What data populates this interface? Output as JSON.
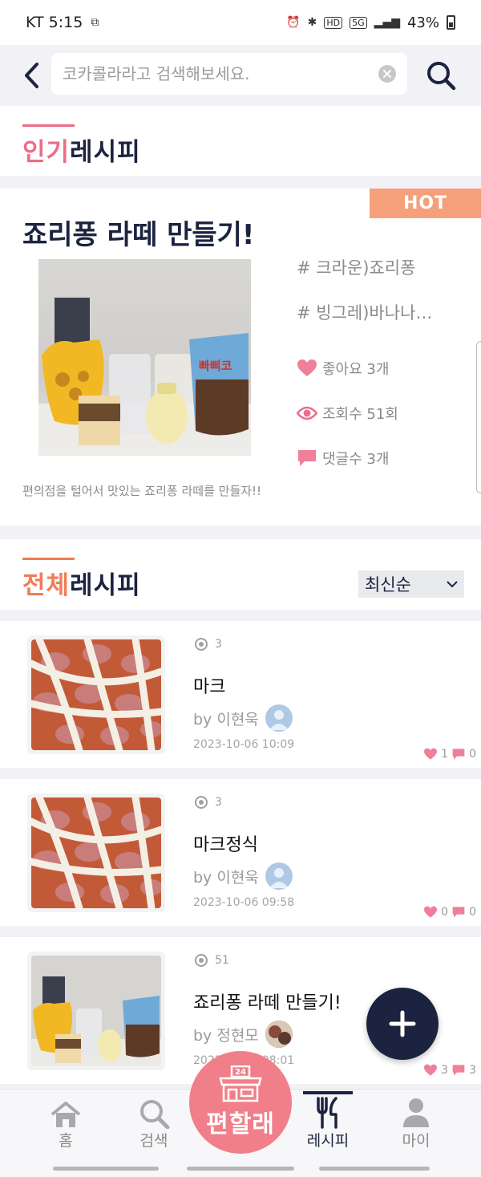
{
  "status_bar": {
    "carrier_time": "KT 5:15",
    "hd_badge": "HD",
    "network_badge": "5G",
    "battery": "43%",
    "battery_level": 0.43
  },
  "search": {
    "placeholder": "코카콜라라고 검색해보세요."
  },
  "popular_section": {
    "title_accent": "인기",
    "title_rest": "레시피",
    "accent_color": "#ee6c86"
  },
  "hot_card": {
    "badge": "HOT",
    "title": "죠리퐁 라떼 만들기!",
    "tags": [
      "# 크라운)죠리퐁",
      "# 빙그레)바나나…"
    ],
    "likes": "좋아요 3개",
    "views": "조회수 51회",
    "comments": "댓글수 3개",
    "description": "편의점을 털어서 맛있는 죠리퐁 라떼를 만들자!!"
  },
  "all_section": {
    "title_accent": "전체",
    "title_rest": "레시피",
    "accent_color": "#ef7d56",
    "sort": "최신순"
  },
  "recipes": [
    {
      "views": "3",
      "name": "마크",
      "author": "by 이현욱",
      "date": "2023-10-06 10:09",
      "likes": "1",
      "comments": "0"
    },
    {
      "views": "3",
      "name": "마크정식",
      "author": "by 이현욱",
      "date": "2023-10-06 09:58",
      "likes": "0",
      "comments": "0"
    },
    {
      "views": "51",
      "name": "죠리퐁 라떼 만들기!",
      "author": "by 정현모",
      "date": "2023-10-06 08:01",
      "likes": "3",
      "comments": "3"
    }
  ],
  "bottom_nav": {
    "home": "홈",
    "search": "검색",
    "center_badge": "24",
    "center": "편할래",
    "recipe": "레시피",
    "my": "마이"
  },
  "colors": {
    "navy": "#1b2340",
    "pink": "#ee6c86",
    "orange": "#ef7d56",
    "hot_badge": "#f5a07a"
  }
}
